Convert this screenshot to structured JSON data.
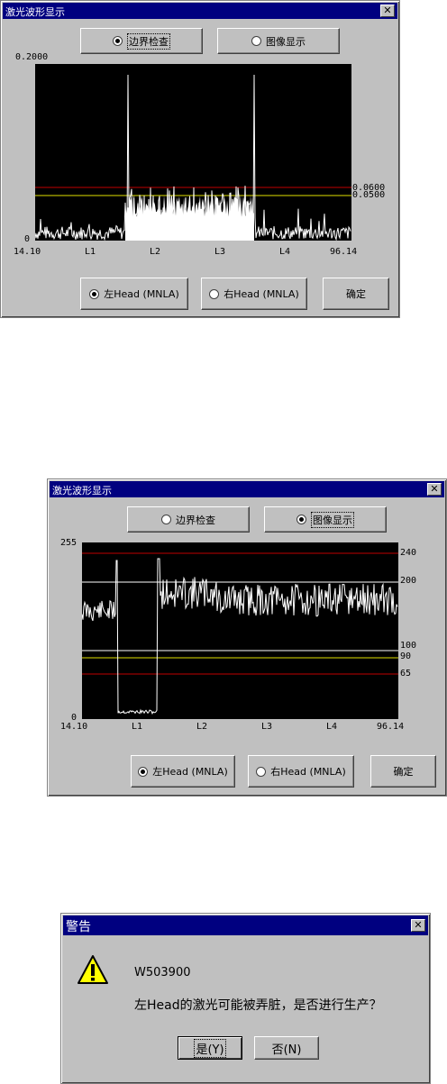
{
  "dialog1": {
    "title": "激光波形显示",
    "close": "✕",
    "radio_edge": "边界检查",
    "radio_image": "图像显示",
    "y_max": "0.2000",
    "y_min": "0",
    "thresholds": [
      "0.0600",
      "0.0500"
    ],
    "x_labels": [
      "14.10",
      "L1",
      "L2",
      "L3",
      "L4",
      "96.14"
    ],
    "head_left": "左Head (MNLA)",
    "head_right": "右Head (MNLA)",
    "ok": "确定",
    "colors": {
      "red_line": "#c00000",
      "yellow_line": "#e0e000",
      "plot_bg": "#000000"
    }
  },
  "dialog2": {
    "title": "激光波形显示",
    "close": "✕",
    "radio_edge": "边界检查",
    "radio_image": "图像显示",
    "y_max": "255",
    "y_min": "0",
    "right_labels": [
      "240",
      "200",
      "100",
      "90",
      "65"
    ],
    "x_labels": [
      "14.10",
      "L1",
      "L2",
      "L3",
      "L4",
      "96.14"
    ],
    "head_left": "左Head (MNLA)",
    "head_right": "右Head (MNLA)",
    "ok": "确定"
  },
  "warning": {
    "title": "警告",
    "close": "✕",
    "code": "W503900",
    "message": "左Head的激光可能被弄脏，是否进行生产？",
    "yes": "是(Y)",
    "no": "否(N)",
    "icon": "warning-icon"
  }
}
